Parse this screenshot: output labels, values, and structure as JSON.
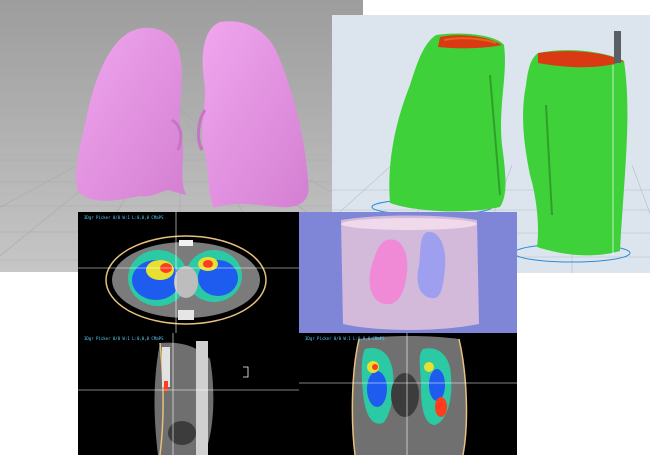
{
  "scene": {
    "composite": "3D printing of lung models from CT",
    "panels": [
      {
        "id": "pink-lung-render",
        "description": "3D rendered pink lungs on gray grid floor"
      },
      {
        "id": "sliced-print-preview",
        "description": "Green lung models with red tops in slicer view"
      },
      {
        "id": "ct-axial",
        "description": "Axial CT slice with perfusion color map"
      },
      {
        "id": "3d-volume-render",
        "description": "Translucent volume render with pink and blue lungs"
      },
      {
        "id": "ct-sagittal",
        "description": "Sagittal CT slice"
      },
      {
        "id": "ct-coronal",
        "description": "Coronal CT slice with perfusion color map"
      }
    ]
  },
  "ct_captions": {
    "axial": "3Dgr Picker 0/0 W:1 L:0,0,0 CMaPS",
    "sagittal": "3Dgr Picker 0/0 W:1 L:0,0,0 CMaPS",
    "coronal": "3Dgr Picker 0/0 W:1 L:0,0,0 CMaPS"
  },
  "colors": {
    "render_bg": "#b4b4b4",
    "lung_pink": "#e38ee0",
    "slicer_bg": "#d9e4ee",
    "print_green": "#3fd13a",
    "print_top_red": "#d93a14",
    "ct_bg": "#000000",
    "volume_bg": "#7f86d8",
    "crosshair": "#ffffff",
    "body_outline": "#e7c17c"
  }
}
